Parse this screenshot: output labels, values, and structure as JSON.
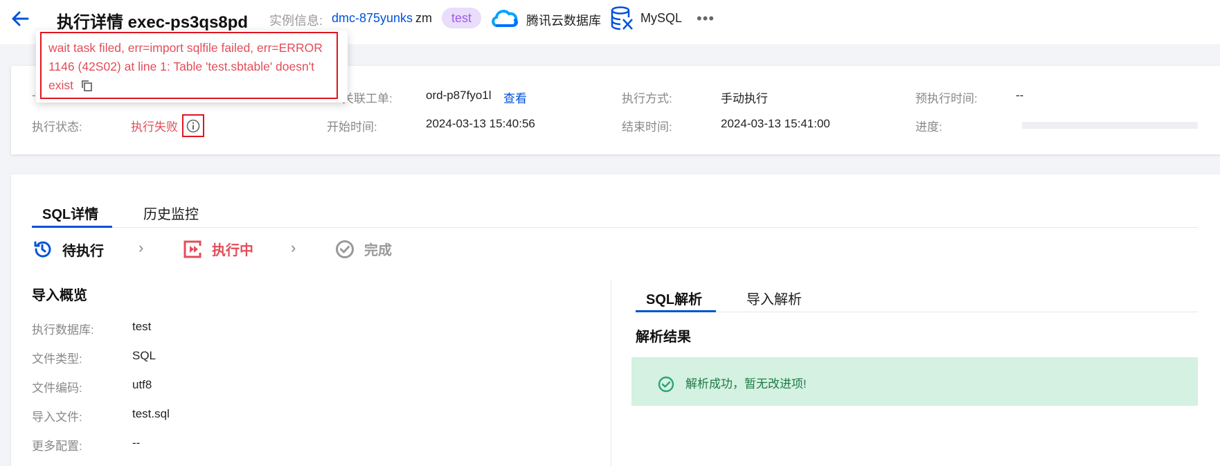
{
  "header": {
    "title": "执行详情 exec-ps3qs8pd",
    "instance_label": "实例信息:",
    "instance_id": "dmc-875yunks",
    "instance_user": "zm",
    "tag": "test",
    "cloud_name": "腾讯云数据库",
    "db_type": "MySQL",
    "more": "•••"
  },
  "tooltip": {
    "message": "wait task filed, err=import sqlfile failed, err=ERROR 1146 (42S02) at line 1: Table 'test.sbtable' doesn't exist"
  },
  "info": {
    "order_label": "关联工单:",
    "order_value": "ord-p87fyo1l",
    "order_link": "查看",
    "method_label": "执行方式:",
    "method_value": "手动执行",
    "planned_label": "预执行时间:",
    "planned_value": "--",
    "status_label": "执行状态:",
    "status_value": "执行失败",
    "start_label": "开始时间:",
    "start_value": "2024-03-13 15:40:56",
    "end_label": "结束时间:",
    "end_value": "2024-03-13 15:41:00",
    "progress_label": "进度:",
    "progress_value": 0
  },
  "tabs": [
    "SQL详情",
    "历史监控"
  ],
  "steps": [
    {
      "label": "待执行"
    },
    {
      "label": "执行中"
    },
    {
      "label": "完成"
    }
  ],
  "overview": {
    "title": "导入概览",
    "rows": [
      {
        "label": "执行数据库:",
        "value": "test"
      },
      {
        "label": "文件类型:",
        "value": "SQL"
      },
      {
        "label": "文件编码:",
        "value": "utf8"
      },
      {
        "label": "导入文件:",
        "value": "test.sql"
      },
      {
        "label": "更多配置:",
        "value": "--"
      }
    ]
  },
  "analysis": {
    "tabs": [
      "SQL解析",
      "导入解析"
    ],
    "title": "解析结果",
    "result": "解析成功，暂无改进项!"
  },
  "colors": {
    "primary": "#0052d9",
    "error": "#e34d59",
    "success_bg": "#d4f1e1",
    "success_text": "#1f7a47"
  }
}
